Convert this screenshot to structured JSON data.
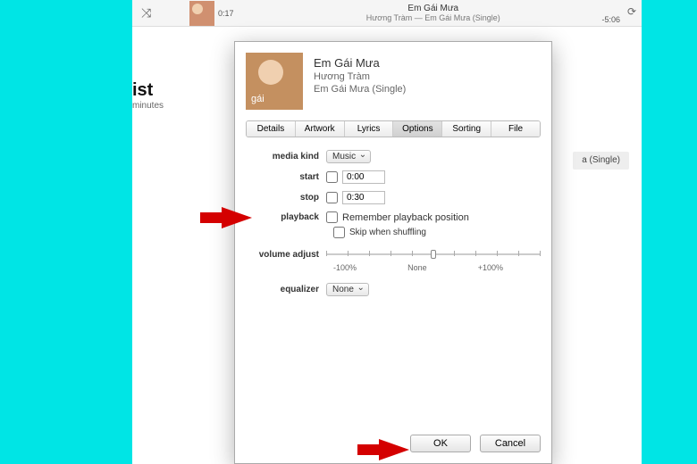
{
  "topbar": {
    "track_title": "Em Gái Mưa",
    "track_sub": "Hương Tràm — Em Gái Mưa (Single)",
    "elapsed": "0:17",
    "remaining": "-5:06"
  },
  "sidebar": {
    "suffix": "ist",
    "minutes": "minutes"
  },
  "content_row": "a (Single)",
  "dialog": {
    "title": "Em Gái Mưa",
    "artist": "Hương Tràm",
    "album": "Em Gái Mưa (Single)",
    "tabs": [
      "Details",
      "Artwork",
      "Lyrics",
      "Options",
      "Sorting",
      "File"
    ],
    "active_tab": "Options",
    "labels": {
      "media_kind": "media kind",
      "start": "start",
      "stop": "stop",
      "playback": "playback",
      "volume_adjust": "volume adjust",
      "equalizer": "equalizer"
    },
    "media_kind_value": "Music",
    "start_value": "0:00",
    "stop_value": "0:30",
    "remember": "Remember playback position",
    "skip_shuffle": "Skip when shuffling",
    "slider_labels": {
      "min": "-100%",
      "mid": "None",
      "max": "+100%"
    },
    "equalizer_value": "None",
    "buttons": {
      "ok": "OK",
      "cancel": "Cancel"
    }
  }
}
